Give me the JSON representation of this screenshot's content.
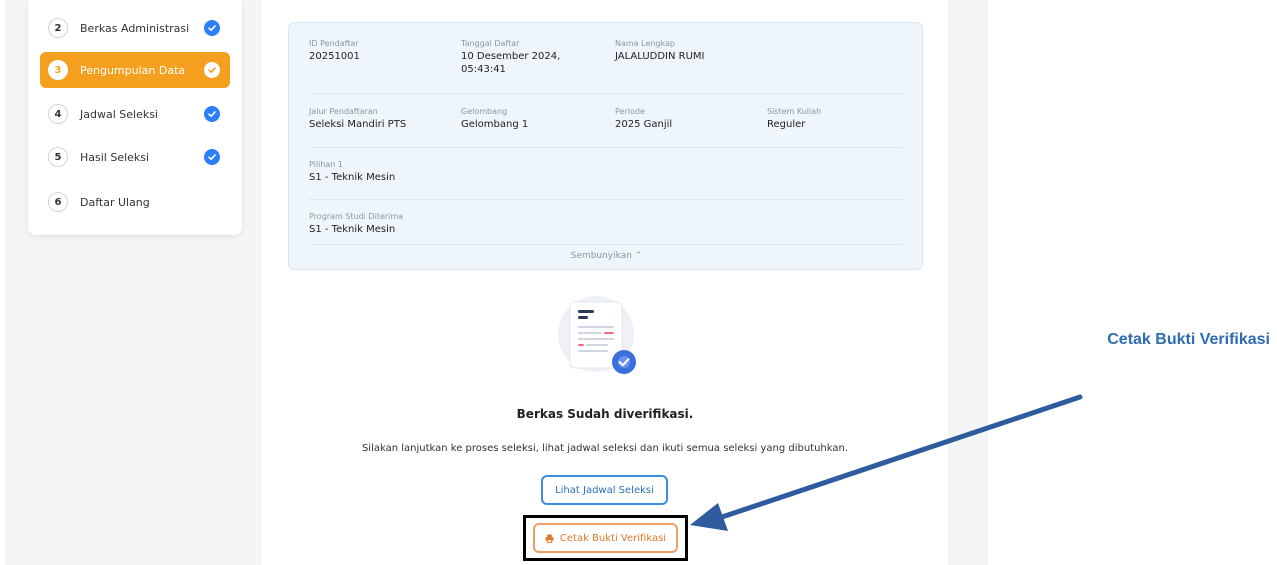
{
  "sidebar": {
    "steps": [
      {
        "num": "2",
        "label": "Berkas Administrasi",
        "done": true,
        "active": false
      },
      {
        "num": "3",
        "label": "Pengumpulan Data",
        "done": true,
        "active": true
      },
      {
        "num": "4",
        "label": "Jadwal Seleksi",
        "done": true,
        "active": false
      },
      {
        "num": "5",
        "label": "Hasil Seleksi",
        "done": true,
        "active": false
      },
      {
        "num": "6",
        "label": "Daftar Ulang",
        "done": false,
        "active": false
      }
    ]
  },
  "info": {
    "id_label": "ID Pendaftar",
    "id_value": "20251001",
    "tanggal_label": "Tanggal Daftar",
    "tanggal_value_line1": "10 Desember 2024,",
    "tanggal_value_line2": "05:43:41",
    "nama_label": "Nama Lengkap",
    "nama_value": "JALALUDDIN RUMI",
    "jalur_label": "Jalur Pendaftaran",
    "jalur_value": "Seleksi Mandiri PTS",
    "gelombang_label": "Gelombang",
    "gelombang_value": "Gelombang 1",
    "periode_label": "Periode",
    "periode_value": "2025 Ganjil",
    "sistem_label": "Sistem Kuliah",
    "sistem_value": "Reguler",
    "pilihan_label": "Pilihan 1",
    "pilihan_value": "S1 - Teknik Mesin",
    "prodi_label": "Program Studi Diterima",
    "prodi_value": "S1 - Teknik Mesin",
    "toggle_label": "Sembunyikan ⌃"
  },
  "status": {
    "headline": "Berkas Sudah diverifikasi.",
    "message": "Silakan lanjutkan ke proses seleksi, lihat jadwal seleksi dan ikuti semua seleksi yang dibutuhkan."
  },
  "buttons": {
    "jadwal_label": "Lihat Jadwal Seleksi",
    "cetak_label": "Cetak Bukti Verifikasi"
  },
  "annotation": {
    "callout_text": "Cetak Bukti Verifikasi"
  },
  "colors": {
    "accent_orange": "#f59f1f",
    "check_blue": "#2d7ff9",
    "callout_blue": "#2f6db3"
  }
}
